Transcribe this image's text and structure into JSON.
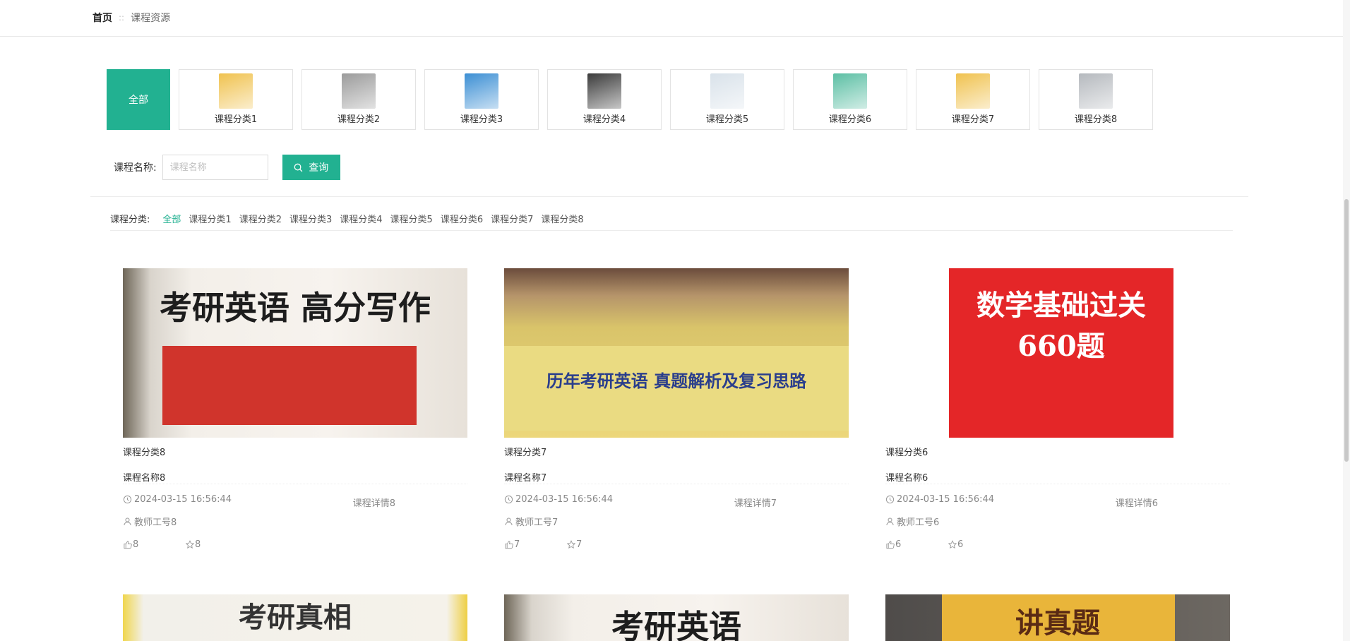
{
  "breadcrumb": {
    "home": "首页",
    "separator": "::",
    "current": "课程资源"
  },
  "tiles": {
    "all_label": "全部",
    "items": [
      {
        "label": "课程分类1",
        "color": "#f0c24f"
      },
      {
        "label": "课程分类2",
        "color": "#9b9b9b"
      },
      {
        "label": "课程分类3",
        "color": "#3c8fd4"
      },
      {
        "label": "课程分类4",
        "color": "#3b3b3b"
      },
      {
        "label": "课程分类5",
        "color": "#d9e2ea"
      },
      {
        "label": "课程分类6",
        "color": "#5cbfa4"
      },
      {
        "label": "课程分类7",
        "color": "#f0c24f"
      },
      {
        "label": "课程分类8",
        "color": "#b5b9be"
      }
    ]
  },
  "search": {
    "label": "课程名称:",
    "placeholder": "课程名称",
    "button": "查询"
  },
  "filter": {
    "label": "课程分类:",
    "items": [
      "全部",
      "课程分类1",
      "课程分类2",
      "课程分类3",
      "课程分类4",
      "课程分类5",
      "课程分类6",
      "课程分类7",
      "课程分类8"
    ]
  },
  "cards": [
    {
      "cover": "考研英语 高分写作",
      "category": "课程分类8",
      "name": "课程名称8",
      "time": "2024-03-15 16:56:44",
      "detail": "课程详情8",
      "teacher": "教师工号8",
      "likes": "8",
      "favorites": "8"
    },
    {
      "cover": "历年考研英语 真题解析及复习思路",
      "category": "课程分类7",
      "name": "课程名称7",
      "time": "2024-03-15 16:56:44",
      "detail": "课程详情7",
      "teacher": "教师工号7",
      "likes": "7",
      "favorites": "7"
    },
    {
      "cover": "数学基础过关 660题",
      "category": "课程分类6",
      "name": "课程名称6",
      "time": "2024-03-15 16:56:44",
      "detail": "课程详情6",
      "teacher": "教师工号6",
      "likes": "6",
      "favorites": "6"
    },
    {
      "cover": "考研真相"
    },
    {
      "cover": "考研英语"
    },
    {
      "cover": "讲真题"
    }
  ]
}
